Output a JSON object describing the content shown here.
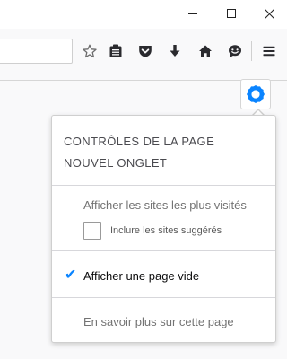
{
  "toolbar": {
    "icons": [
      "bookmark-star-icon",
      "library-icon",
      "pocket-icon",
      "download-icon",
      "home-icon",
      "chat-icon",
      "hamburger-menu-icon"
    ]
  },
  "window_controls": [
    "minimize-icon",
    "maximize-icon",
    "close-icon"
  ],
  "gear": {
    "icon": "gear-icon",
    "color": "#0a84ff"
  },
  "panel": {
    "heading_line1": "CONTRÔLES DE LA PAGE",
    "heading_line2": "NOUVEL ONGLET",
    "option_most_visited": "Afficher les sites les plus visités",
    "checkbox_suggested_label": "Inclure les sites suggérés",
    "checkbox_suggested_checked": false,
    "option_blank_page": "Afficher une page vide",
    "option_blank_page_selected": true,
    "learn_more": "En savoir plus sur cette page"
  }
}
